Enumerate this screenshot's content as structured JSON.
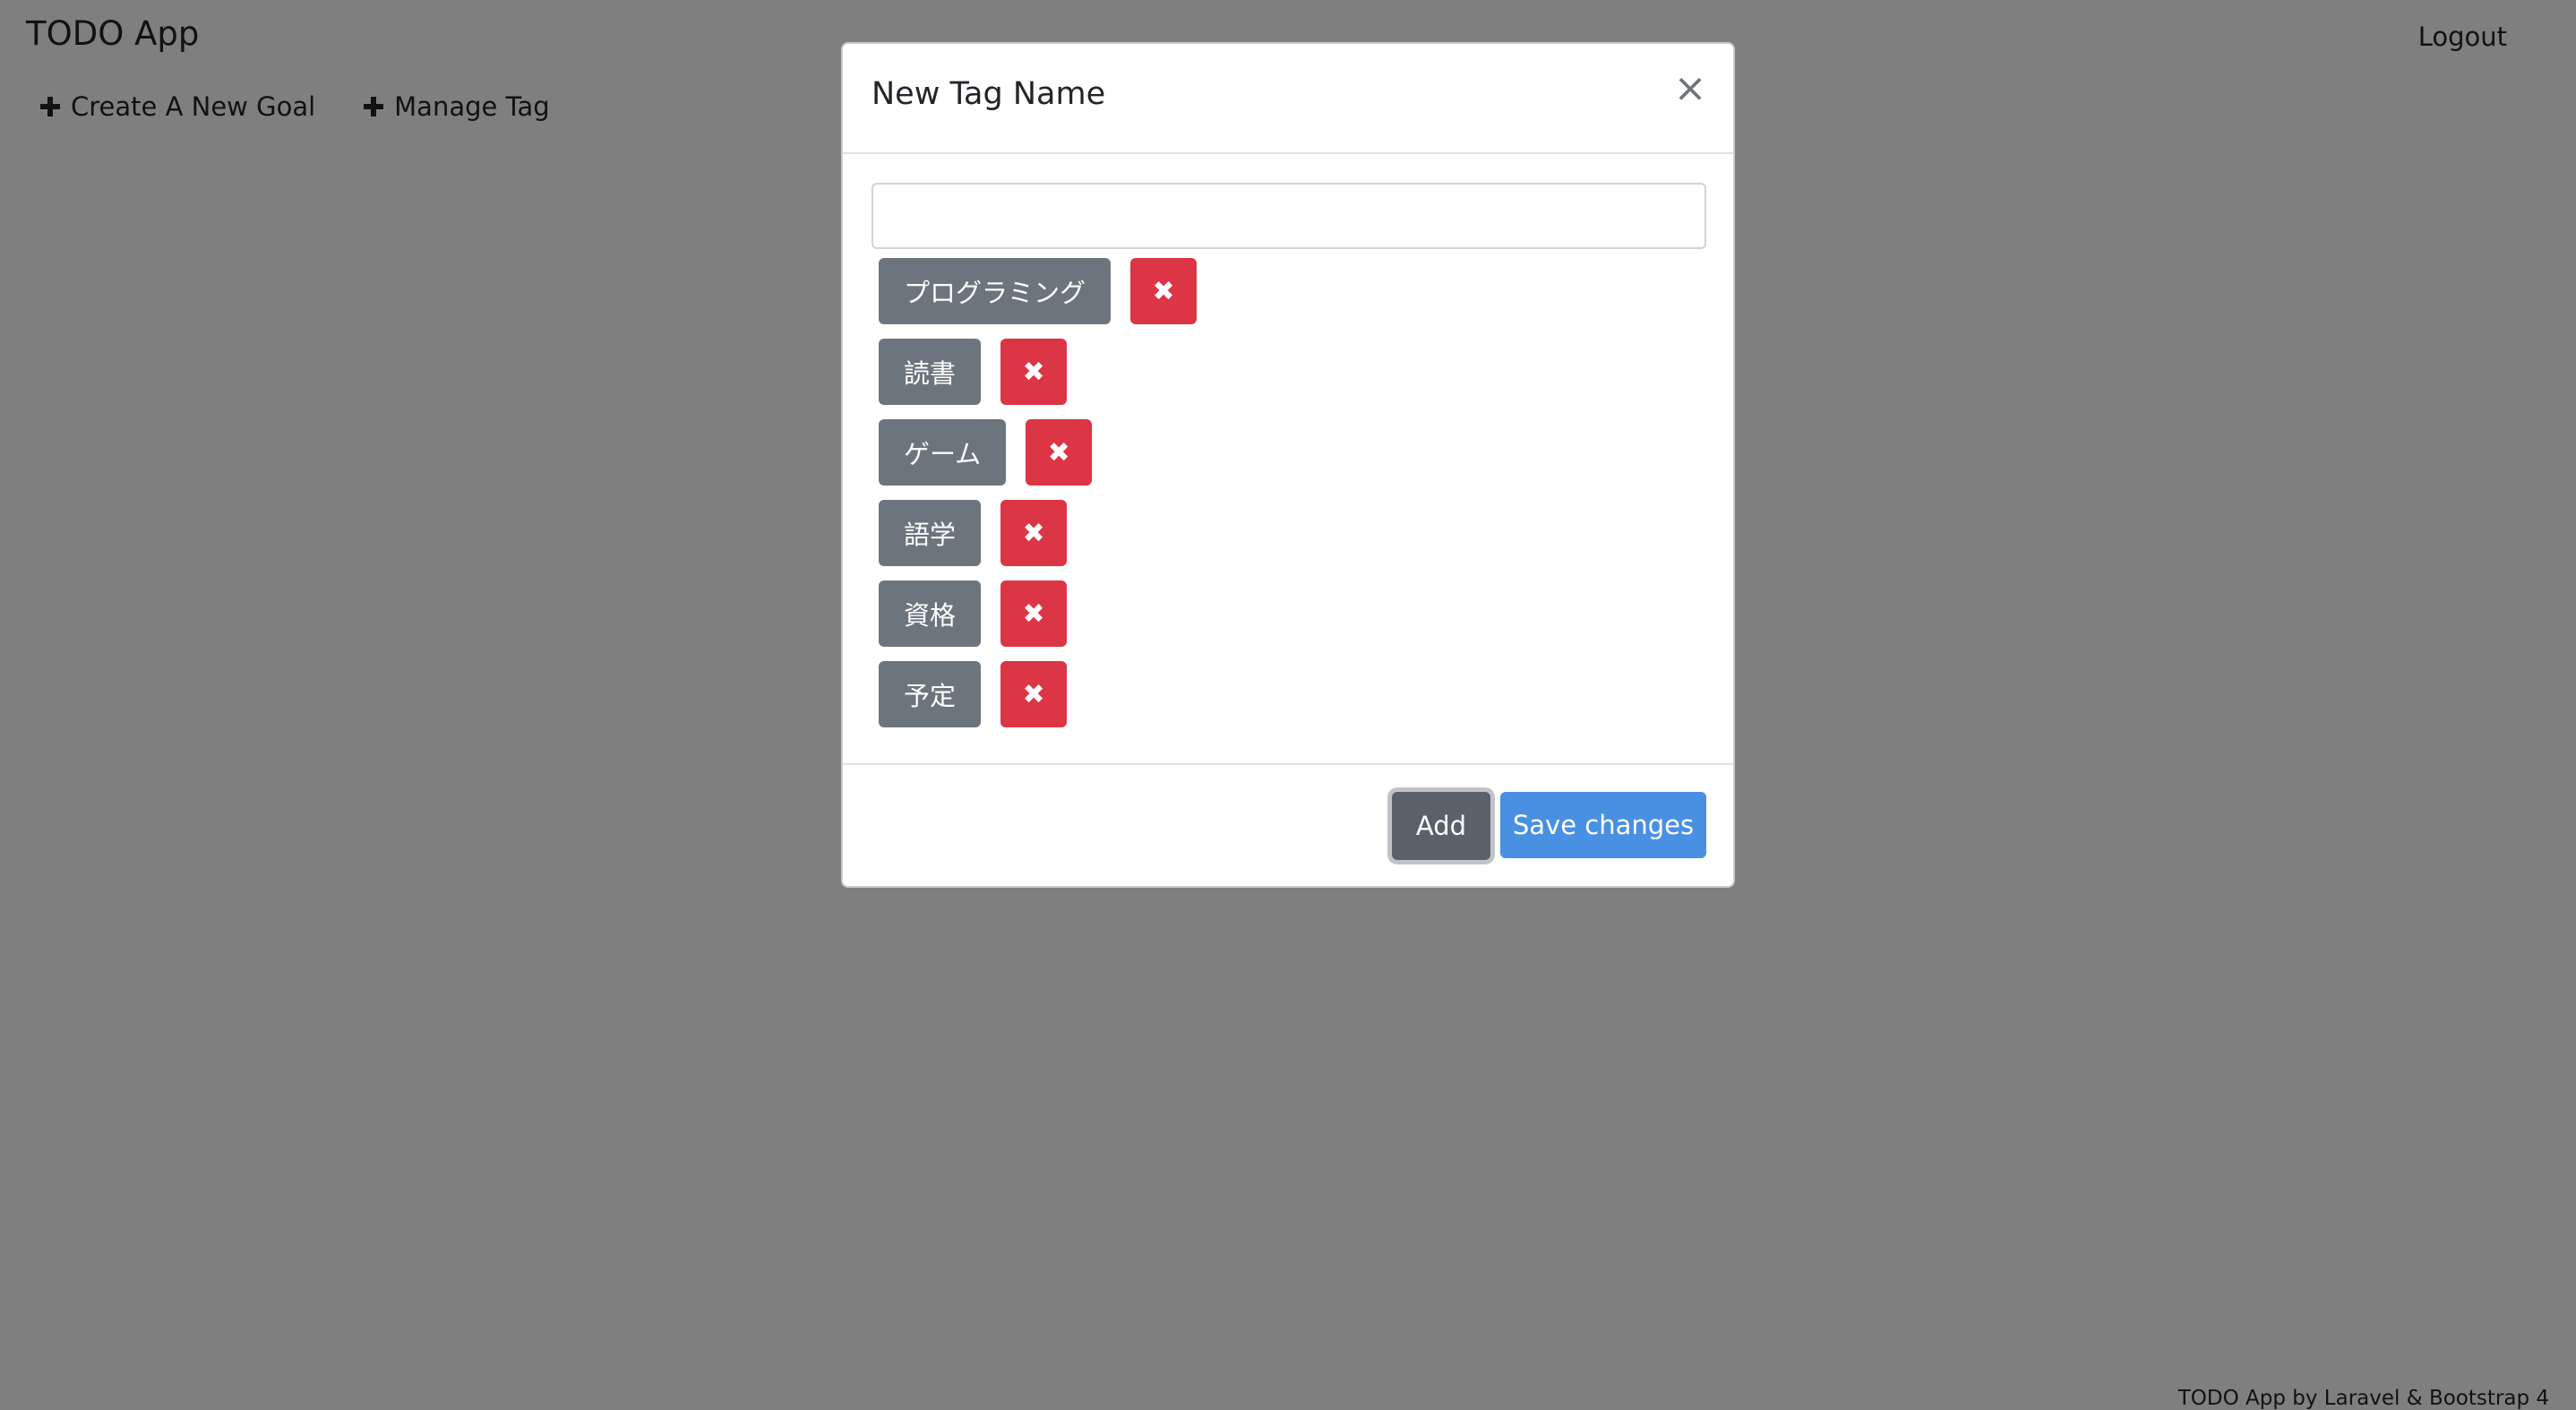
{
  "navbar": {
    "brand": "TODO App",
    "logout": "Logout"
  },
  "subnav": {
    "create_goal": "Create A New Goal",
    "manage_tag": "Manage Tag"
  },
  "footer": {
    "credit": "TODO App by Laravel & Bootstrap 4"
  },
  "modal": {
    "title": "New Tag Name",
    "close_glyph": "×",
    "input_value": "",
    "delete_glyph": "✖",
    "tags": [
      {
        "label": "プログラミング"
      },
      {
        "label": "読書"
      },
      {
        "label": "ゲーム"
      },
      {
        "label": "語学"
      },
      {
        "label": "資格"
      },
      {
        "label": "予定"
      }
    ],
    "add_label": "Add",
    "save_label": "Save changes"
  },
  "colors": {
    "tag": "#6c757d",
    "delete": "#dc3545",
    "add": "#5a6268",
    "save": "#4a90e2"
  }
}
